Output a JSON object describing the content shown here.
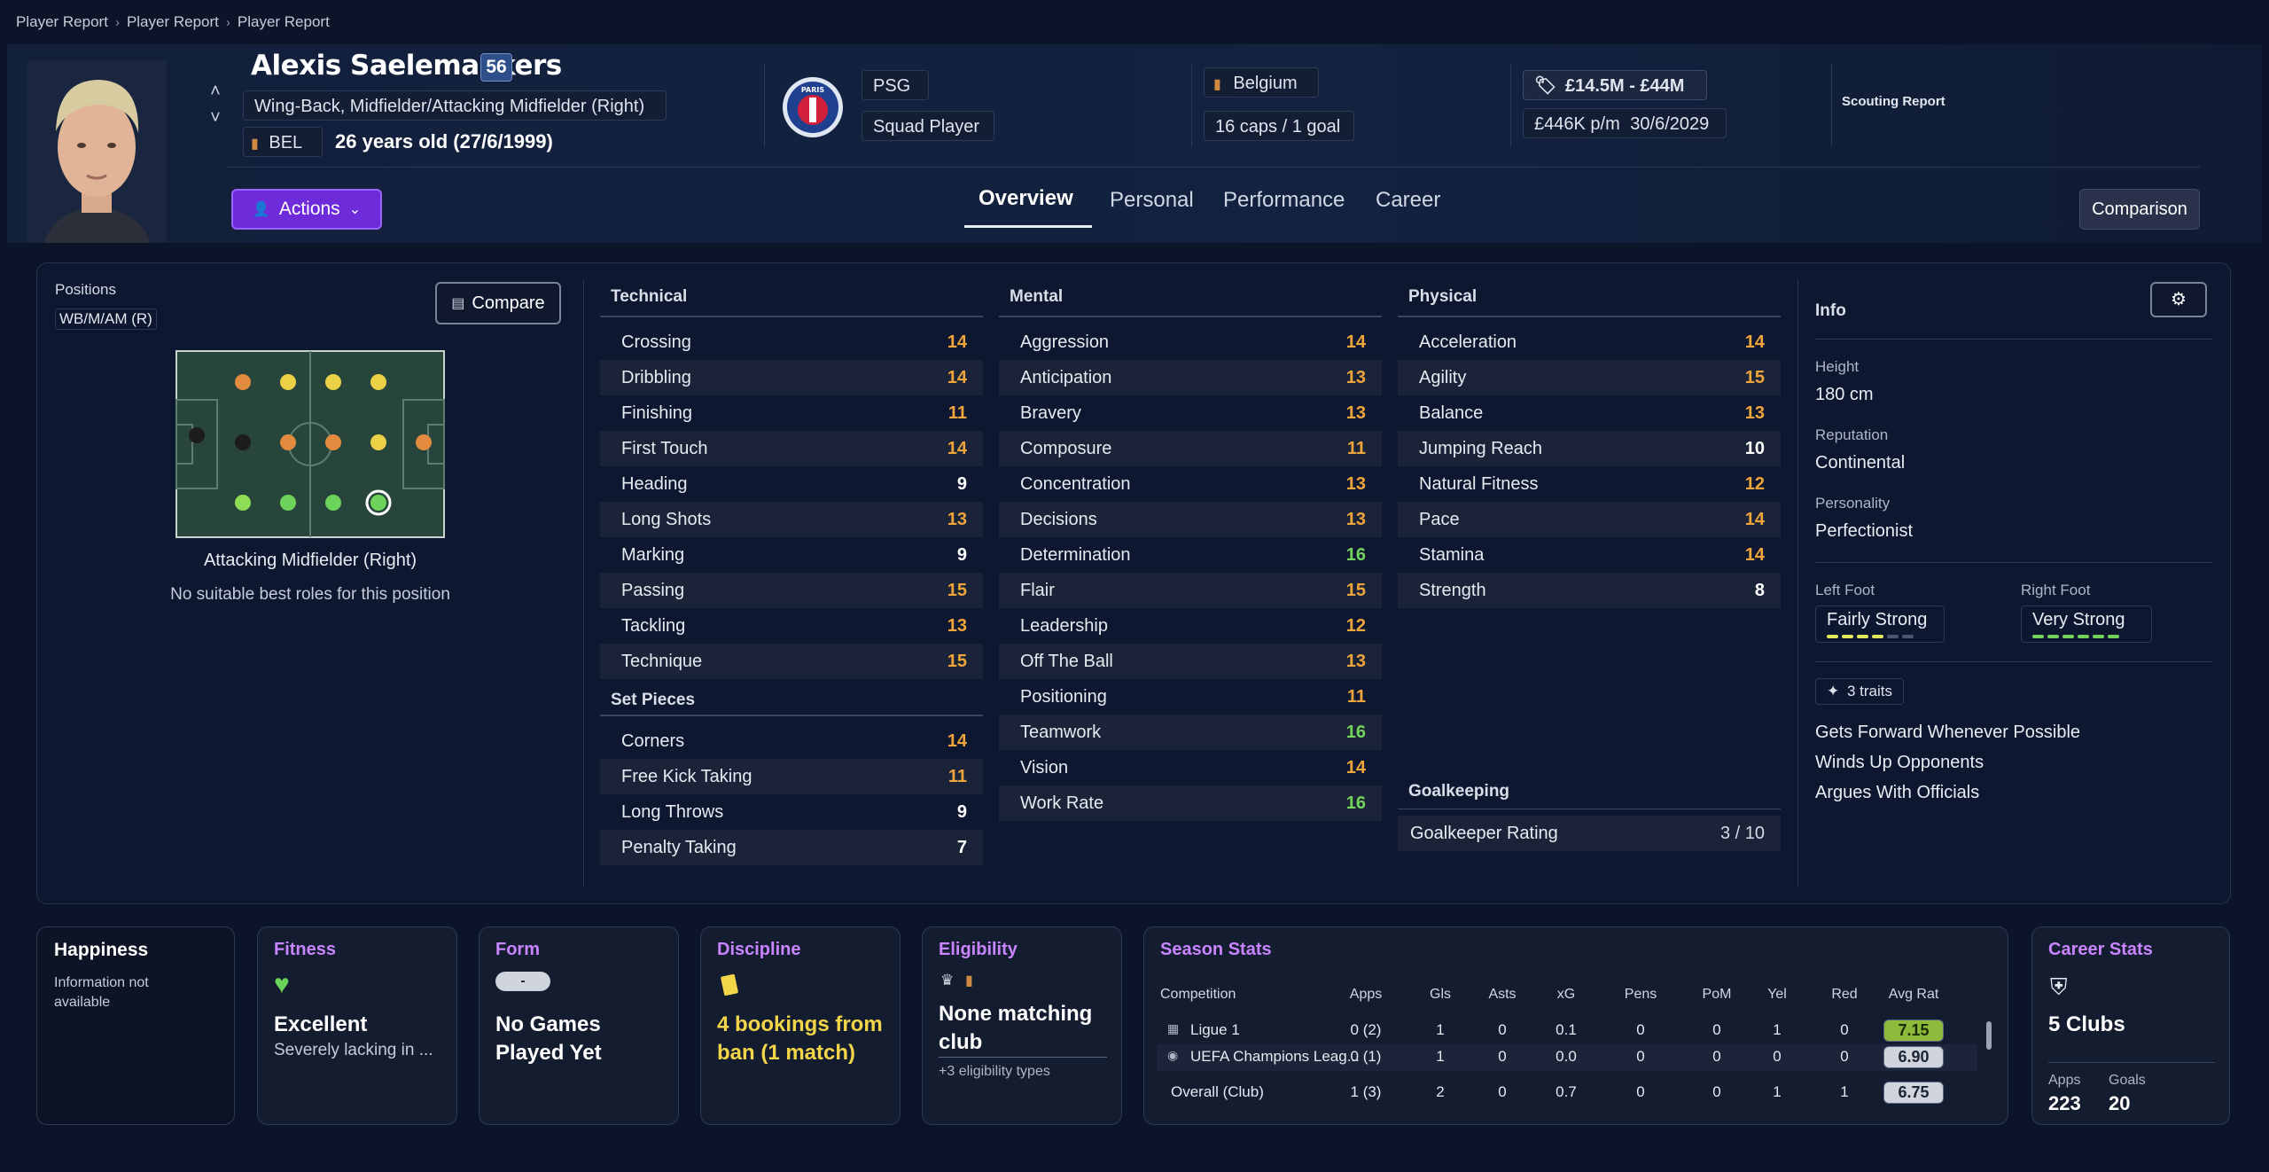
{
  "breadcrumb": [
    "Player Report",
    "Player Report",
    "Player Report"
  ],
  "player": {
    "name": "Alexis Saelemaekers",
    "rating": "56",
    "positions": "Wing-Back, Midfielder/Attacking Midfielder (Right)",
    "nationality_code": "BEL",
    "age": "26 years old (27/6/1999)"
  },
  "club": {
    "name": "PSG",
    "crest_text": "PARIS",
    "status": "Squad Player"
  },
  "nation": {
    "name": "Belgium",
    "caps": "16 caps / 1 goal"
  },
  "value": {
    "range": "£14.5M - £44M",
    "wage": "£446K p/m",
    "contract": "30/6/2029"
  },
  "scouting_report": "Scouting Report",
  "actions_label": "Actions",
  "tabs": [
    "Overview",
    "Personal",
    "Performance",
    "Career"
  ],
  "comparison_label": "Comparison",
  "positions_panel": {
    "title": "Positions",
    "short": "WB/M/AM (R)",
    "compare_label": "Compare",
    "selected_role": "Attacking Midfielder (Right)",
    "note": "No suitable best roles for this position"
  },
  "technical": {
    "title": "Technical",
    "rows": [
      {
        "name": "Crossing",
        "value": "14",
        "tone": "o"
      },
      {
        "name": "Dribbling",
        "value": "14",
        "tone": "o"
      },
      {
        "name": "Finishing",
        "value": "11",
        "tone": "o"
      },
      {
        "name": "First Touch",
        "value": "14",
        "tone": "o"
      },
      {
        "name": "Heading",
        "value": "9",
        "tone": "w"
      },
      {
        "name": "Long Shots",
        "value": "13",
        "tone": "o"
      },
      {
        "name": "Marking",
        "value": "9",
        "tone": "w"
      },
      {
        "name": "Passing",
        "value": "15",
        "tone": "o"
      },
      {
        "name": "Tackling",
        "value": "13",
        "tone": "o"
      },
      {
        "name": "Technique",
        "value": "15",
        "tone": "o"
      }
    ]
  },
  "set_pieces": {
    "title": "Set Pieces",
    "rows": [
      {
        "name": "Corners",
        "value": "14",
        "tone": "o"
      },
      {
        "name": "Free Kick Taking",
        "value": "11",
        "tone": "o"
      },
      {
        "name": "Long Throws",
        "value": "9",
        "tone": "w"
      },
      {
        "name": "Penalty Taking",
        "value": "7",
        "tone": "w"
      }
    ]
  },
  "mental": {
    "title": "Mental",
    "rows": [
      {
        "name": "Aggression",
        "value": "14",
        "tone": "o"
      },
      {
        "name": "Anticipation",
        "value": "13",
        "tone": "o"
      },
      {
        "name": "Bravery",
        "value": "13",
        "tone": "o"
      },
      {
        "name": "Composure",
        "value": "11",
        "tone": "o"
      },
      {
        "name": "Concentration",
        "value": "13",
        "tone": "o"
      },
      {
        "name": "Decisions",
        "value": "13",
        "tone": "o"
      },
      {
        "name": "Determination",
        "value": "16",
        "tone": "g"
      },
      {
        "name": "Flair",
        "value": "15",
        "tone": "o"
      },
      {
        "name": "Leadership",
        "value": "12",
        "tone": "o"
      },
      {
        "name": "Off The Ball",
        "value": "13",
        "tone": "o"
      },
      {
        "name": "Positioning",
        "value": "11",
        "tone": "o"
      },
      {
        "name": "Teamwork",
        "value": "16",
        "tone": "g"
      },
      {
        "name": "Vision",
        "value": "14",
        "tone": "o"
      },
      {
        "name": "Work Rate",
        "value": "16",
        "tone": "g"
      }
    ]
  },
  "physical": {
    "title": "Physical",
    "rows": [
      {
        "name": "Acceleration",
        "value": "14",
        "tone": "o"
      },
      {
        "name": "Agility",
        "value": "15",
        "tone": "o"
      },
      {
        "name": "Balance",
        "value": "13",
        "tone": "o"
      },
      {
        "name": "Jumping Reach",
        "value": "10",
        "tone": "w"
      },
      {
        "name": "Natural Fitness",
        "value": "12",
        "tone": "o"
      },
      {
        "name": "Pace",
        "value": "14",
        "tone": "o"
      },
      {
        "name": "Stamina",
        "value": "14",
        "tone": "o"
      },
      {
        "name": "Strength",
        "value": "8",
        "tone": "w"
      }
    ]
  },
  "goalkeeping": {
    "title": "Goalkeeping",
    "label": "Goalkeeper Rating",
    "value": "3 / 10"
  },
  "info": {
    "title": "Info",
    "height_label": "Height",
    "height": "180 cm",
    "reputation_label": "Reputation",
    "reputation": "Continental",
    "personality_label": "Personality",
    "personality": "Perfectionist",
    "left_foot_label": "Left Foot",
    "left_foot": "Fairly Strong",
    "left_foot_level": 4,
    "right_foot_label": "Right Foot",
    "right_foot": "Very Strong",
    "right_foot_level": 6,
    "traits_label": "3 traits",
    "traits": [
      "Gets Forward Whenever Possible",
      "Winds Up Opponents",
      "Argues With Officials"
    ]
  },
  "happiness": {
    "title": "Happiness",
    "text": "Information not available"
  },
  "fitness": {
    "title": "Fitness",
    "value": "Excellent",
    "note": "Severely lacking in ..."
  },
  "form": {
    "title": "Form",
    "badge": "-",
    "value": "No Games Played Yet"
  },
  "discipline": {
    "title": "Discipline",
    "value": "4 bookings from ban (1 match)"
  },
  "eligibility": {
    "title": "Eligibility",
    "value": "None matching club",
    "note": "+3 eligibility types"
  },
  "season_stats": {
    "title": "Season Stats",
    "headers": [
      "Competition",
      "Apps",
      "Gls",
      "Asts",
      "xG",
      "Pens",
      "PoM",
      "Yel",
      "Red",
      "Avg Rat"
    ],
    "rows": [
      [
        "Ligue 1",
        "0 (2)",
        "1",
        "0",
        "0.1",
        "0",
        "0",
        "1",
        "0",
        "7.15"
      ],
      [
        "UEFA Champions Leag...",
        "0 (1)",
        "1",
        "0",
        "0.0",
        "0",
        "0",
        "0",
        "0",
        "6.90"
      ],
      [
        "Overall (Club)",
        "1 (3)",
        "2",
        "0",
        "0.7",
        "0",
        "0",
        "1",
        "1",
        "6.75"
      ]
    ]
  },
  "career_stats": {
    "title": "Career Stats",
    "clubs": "5 Clubs",
    "apps_label": "Apps",
    "apps": "223",
    "goals_label": "Goals",
    "goals": "20"
  },
  "colors": {
    "accent": "#6d2bd9",
    "orange": "#f0a53c",
    "green": "#74d35a",
    "yellow": "#f2d548",
    "card_title": "#c985ff"
  }
}
